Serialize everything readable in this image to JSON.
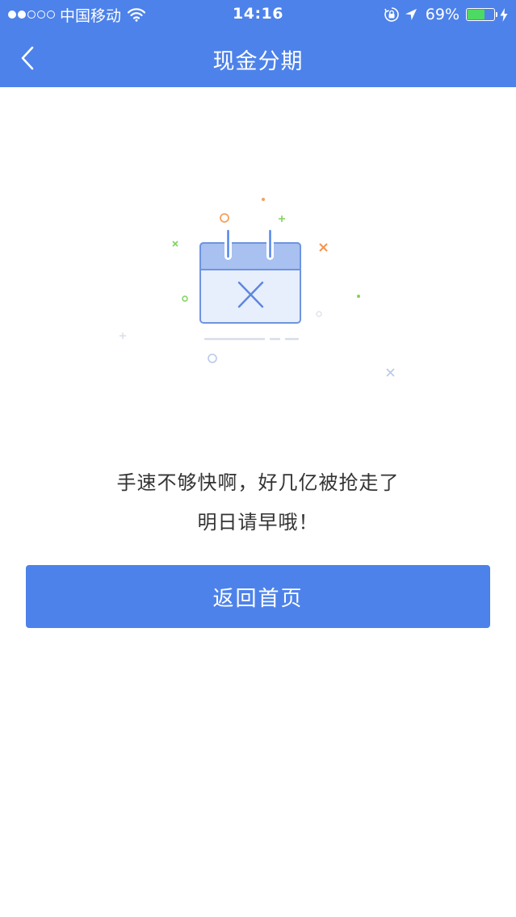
{
  "status_bar": {
    "signal_strength": "2 of 5",
    "carrier": "中国移动",
    "time": "14:16",
    "battery_percent": "69%",
    "battery_level": 0.69,
    "icons": [
      "wifi-icon",
      "rotation-lock-icon",
      "location-arrow-icon",
      "battery-icon",
      "charging-icon"
    ]
  },
  "nav": {
    "title": "现金分期",
    "back_icon": "chevron-left-icon"
  },
  "illustration": {
    "icon": "calendar-closed-icon"
  },
  "message": {
    "line1": "手速不够快啊，好几亿被抢走了",
    "line2": "明日请早哦！"
  },
  "actions": {
    "home_label": "返回首页"
  },
  "colors": {
    "brand": "#4d82ea",
    "background": "#ffffff",
    "text": "#333333",
    "battery_fill": "#4cd964"
  }
}
